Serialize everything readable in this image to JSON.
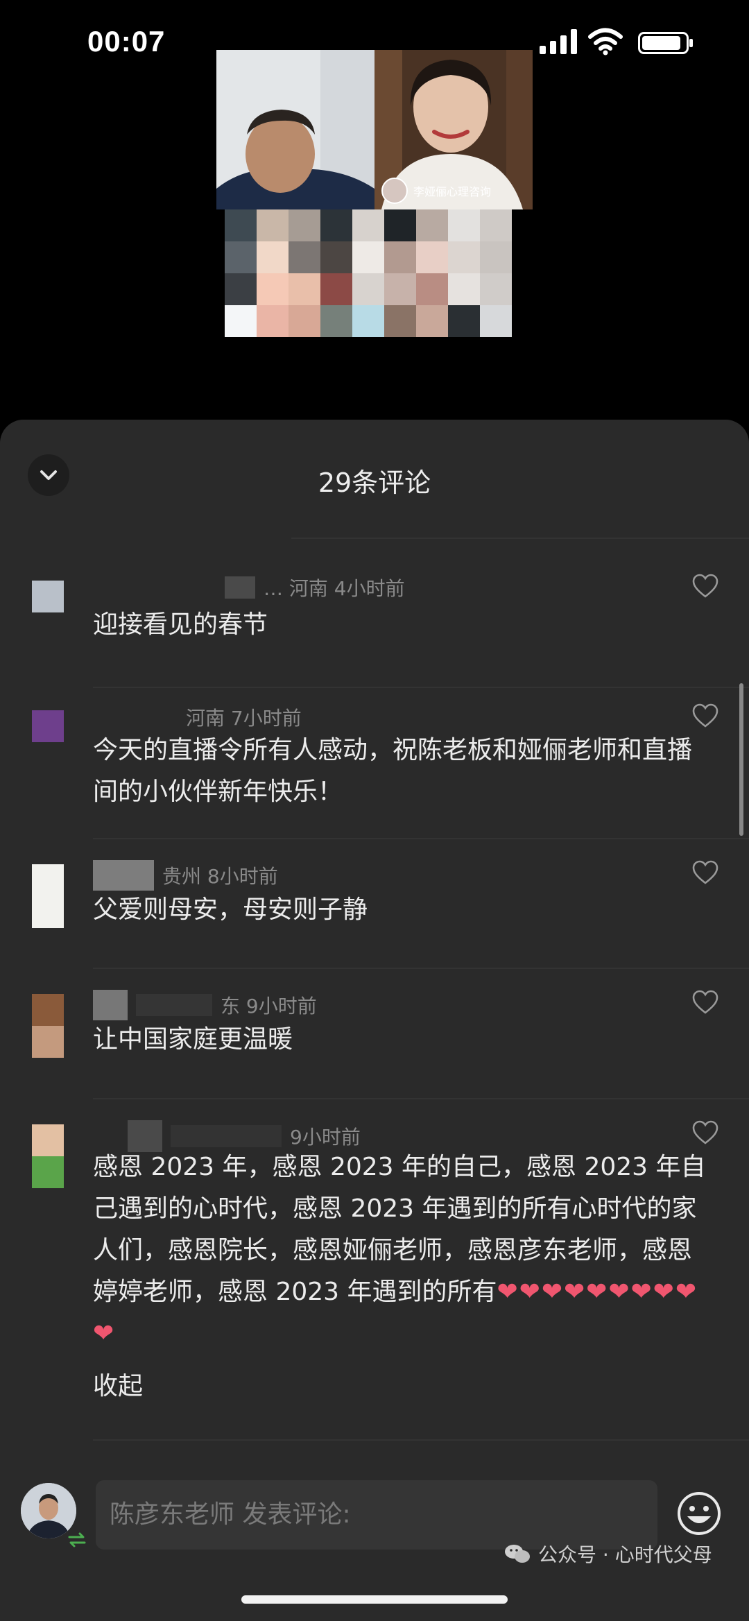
{
  "status_bar": {
    "time": "00:07"
  },
  "video": {
    "host_name_tag": "李娅俪心理咨询"
  },
  "comments_panel": {
    "title": "29条评论",
    "comments": [
      {
        "meta": "… 河南 4小时前",
        "text": "迎接看见的春节"
      },
      {
        "meta": "河南 7小时前",
        "text": "今天的直播令所有人感动，祝陈老板和娅俪老师和直播间的小伙伴新年快乐！"
      },
      {
        "meta": "贵州 8小时前",
        "text": "父爱则母安，母安则子静"
      },
      {
        "meta": "东 9小时前",
        "text": "让中国家庭更温暖"
      },
      {
        "meta": "9小时前",
        "text": "感恩 2023 年，感恩 2023 年的自己，感恩 2023 年自己遇到的心时代，感恩 2023 年遇到的所有心时代的家人们，感恩院长，感恩娅俪老师，感恩彦东老师，感恩婷婷老师，感恩 2023 年遇到的所有",
        "hearts": "❤❤❤❤❤❤❤❤❤❤",
        "fold_label": "收起"
      }
    ]
  },
  "composer": {
    "placeholder": "陈彦东老师 发表评论:"
  },
  "watermark": "公众号 · 心时代父母",
  "colors": {
    "sheet_bg": "#2a2a2a",
    "heart_red": "#f0566f"
  }
}
